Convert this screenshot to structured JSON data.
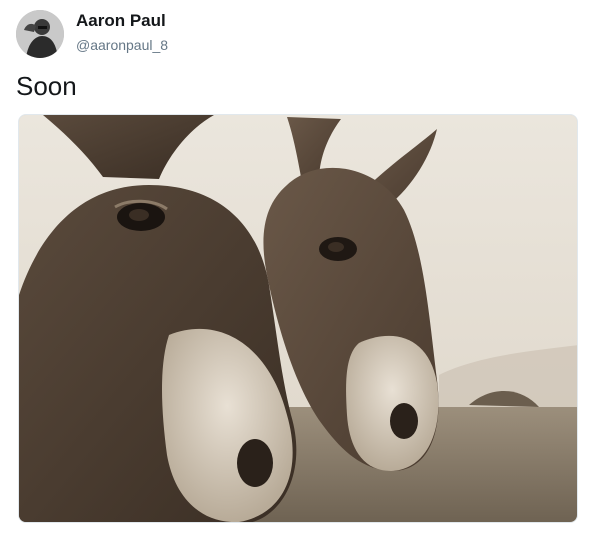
{
  "author": {
    "display_name": "Aaron Paul",
    "handle": "@aaronpaul_8",
    "avatar_icon": "profile-photo"
  },
  "tweet": {
    "text": "Soon"
  },
  "media": {
    "type": "photo",
    "tone": "sepia"
  }
}
